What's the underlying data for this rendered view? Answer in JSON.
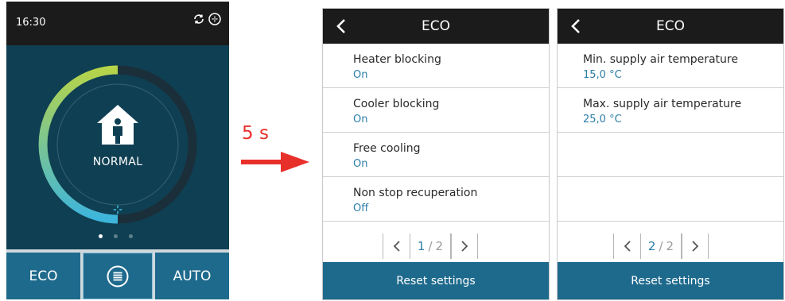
{
  "home": {
    "time": "16:30",
    "status_icons": [
      "sync-icon",
      "fan-status-icon"
    ],
    "mode": "NORMAL",
    "page_indicator": {
      "count": 3,
      "active": 1
    },
    "bottom": {
      "left_label": "ECO",
      "center_icon": "menu-icon",
      "right_label": "AUTO"
    },
    "colors": {
      "bg": "#0f3f52",
      "arc_start": "#b6d44a",
      "arc_end": "#3db5dc",
      "button": "#1e6a8d"
    }
  },
  "transition": {
    "label": "5 s",
    "color": "#e8302a"
  },
  "panel1": {
    "title": "ECO",
    "items": [
      {
        "title": "Heater blocking",
        "value": "On"
      },
      {
        "title": "Cooler blocking",
        "value": "On"
      },
      {
        "title": "Free cooling",
        "value": "On"
      },
      {
        "title": "Non stop recuperation",
        "value": "Off"
      }
    ],
    "pager": {
      "current": "1",
      "total": "2"
    },
    "reset_label": "Reset settings"
  },
  "panel2": {
    "title": "ECO",
    "items": [
      {
        "title": "Min. supply air temperature",
        "value": "15,0 °C"
      },
      {
        "title": "Max. supply air temperature",
        "value": "25,0 °C"
      },
      {
        "title": "",
        "value": ""
      },
      {
        "title": "",
        "value": ""
      }
    ],
    "pager": {
      "current": "2",
      "total": "2"
    },
    "reset_label": "Reset settings"
  }
}
